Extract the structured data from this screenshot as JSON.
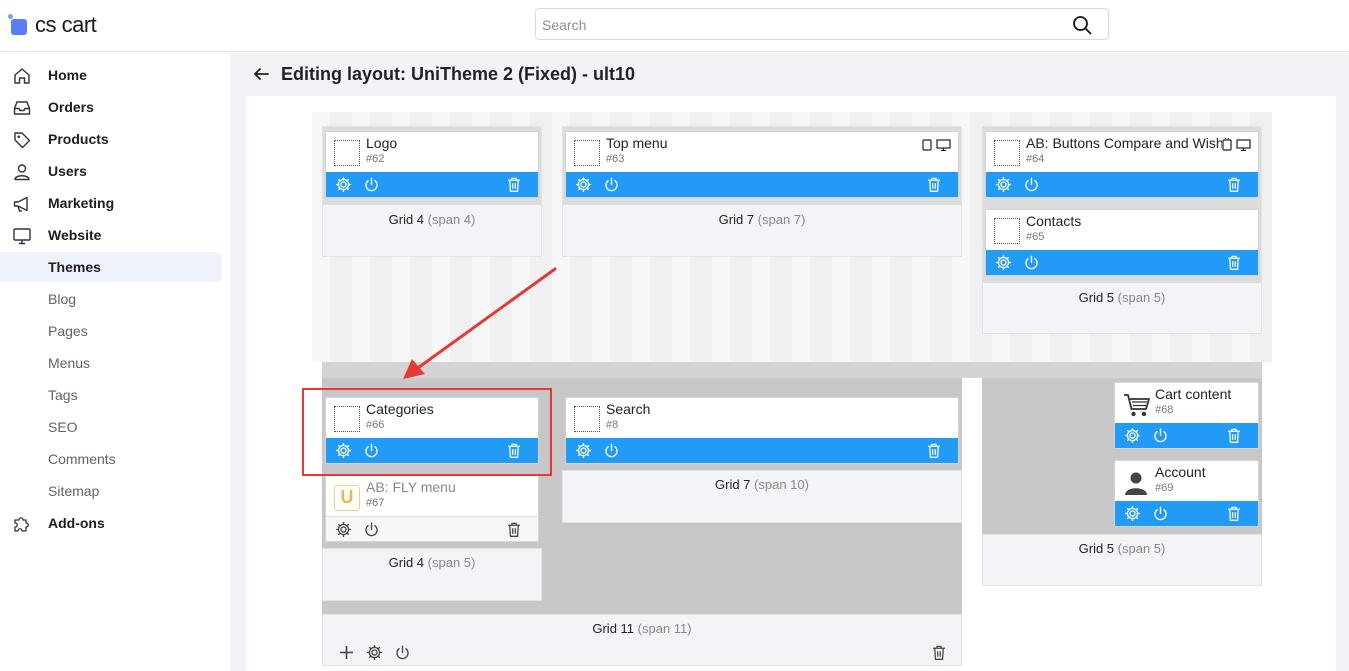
{
  "app": {
    "logo_text": "cs cart"
  },
  "search": {
    "placeholder": "Search"
  },
  "sidebar": {
    "items": [
      {
        "label": "Home",
        "icon": "home-icon"
      },
      {
        "label": "Orders",
        "icon": "inbox-icon"
      },
      {
        "label": "Products",
        "icon": "tag-icon"
      },
      {
        "label": "Users",
        "icon": "user-icon"
      },
      {
        "label": "Marketing",
        "icon": "megaphone-icon"
      },
      {
        "label": "Website",
        "icon": "monitor-icon"
      },
      {
        "label": "Themes"
      },
      {
        "label": "Blog"
      },
      {
        "label": "Pages"
      },
      {
        "label": "Menus"
      },
      {
        "label": "Tags"
      },
      {
        "label": "SEO"
      },
      {
        "label": "Comments"
      },
      {
        "label": "Sitemap"
      },
      {
        "label": "Add-ons",
        "icon": "puzzle-icon"
      }
    ],
    "active": "Themes"
  },
  "page": {
    "title": "Editing layout: UniTheme 2 (Fixed) - ult10"
  },
  "layout": {
    "grids": [
      {
        "name": "Grid 4",
        "span": "(span 4)"
      },
      {
        "name": "Grid 7",
        "span": "(span 7)"
      },
      {
        "name": "Grid 5",
        "span": "(span 5)"
      },
      {
        "name": "Grid 4",
        "span": "(span 5)"
      },
      {
        "name": "Grid 7",
        "span": "(span 10)"
      },
      {
        "name": "Grid 5",
        "span": "(span 5)"
      },
      {
        "name": "Grid 11",
        "span": "(span 11)"
      }
    ],
    "blocks": [
      {
        "name": "Logo",
        "id": "#62"
      },
      {
        "name": "Top menu",
        "id": "#63"
      },
      {
        "name": "AB: Buttons Compare and Wishlist",
        "id": "#64"
      },
      {
        "name": "Contacts",
        "id": "#65"
      },
      {
        "name": "Categories",
        "id": "#66"
      },
      {
        "name": "AB: FLY menu",
        "id": "#67",
        "icon_letter": "U"
      },
      {
        "name": "Search",
        "id": "#8"
      },
      {
        "name": "Cart content",
        "id": "#68"
      },
      {
        "name": "Account",
        "id": "#69"
      }
    ]
  },
  "colors": {
    "accent": "#219bf5",
    "highlight": "#e53935"
  }
}
